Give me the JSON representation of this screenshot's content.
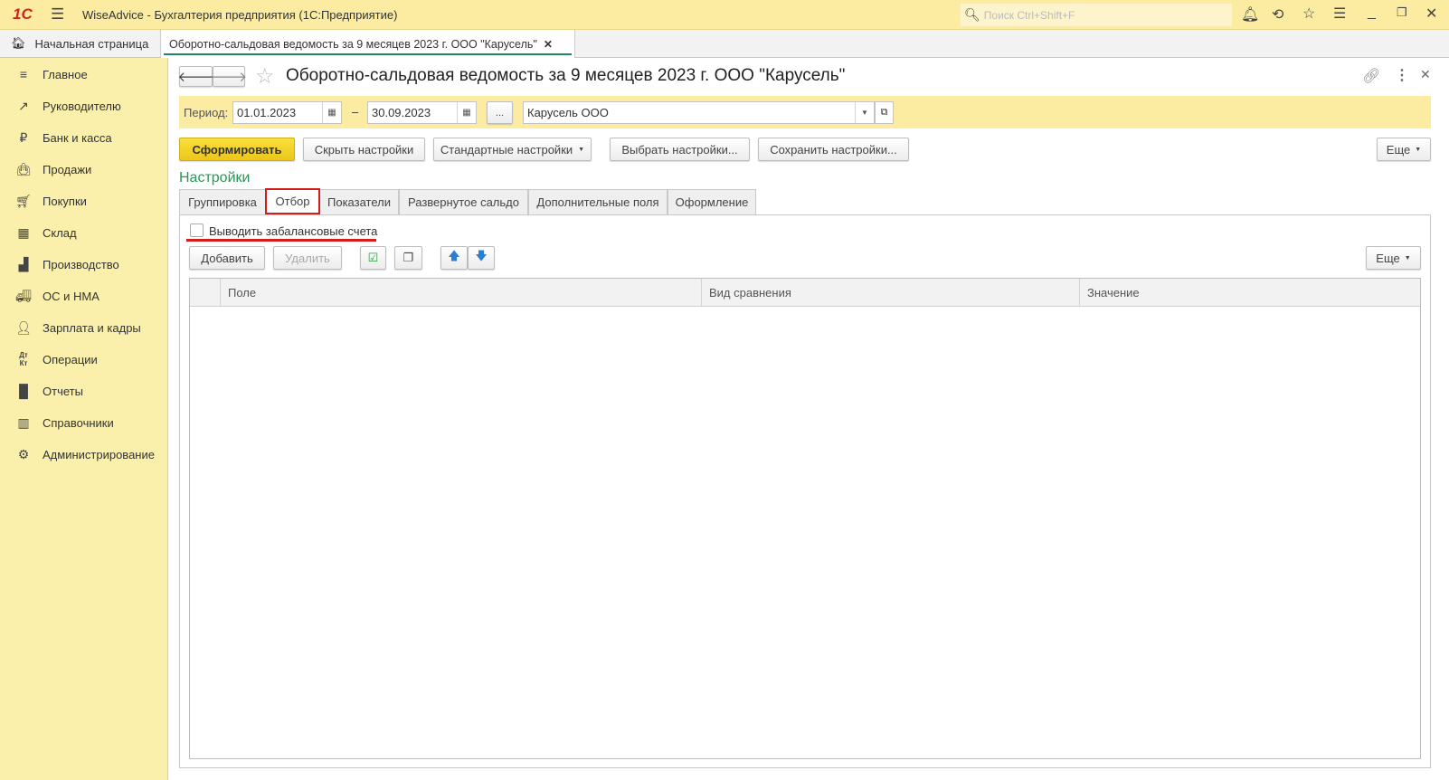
{
  "titlebar": {
    "app_title": "WiseAdvice - Бухгалтерия предприятия  (1С:Предприятие)",
    "search_placeholder": "Поиск Ctrl+Shift+F",
    "logo": "1С"
  },
  "tabs": {
    "home": "Начальная страница",
    "active": "Оборотно-сальдовая ведомость за 9 месяцев 2023 г. ООО \"Карусель\""
  },
  "sidebar": {
    "items": [
      {
        "label": "Главное",
        "icon": "menu-icon"
      },
      {
        "label": "Руководителю",
        "icon": "trend-icon"
      },
      {
        "label": "Банк и касса",
        "icon": "ruble-icon"
      },
      {
        "label": "Продажи",
        "icon": "bag-icon"
      },
      {
        "label": "Покупки",
        "icon": "cart-icon"
      },
      {
        "label": "Склад",
        "icon": "warehouse-icon"
      },
      {
        "label": "Производство",
        "icon": "factory-icon"
      },
      {
        "label": "ОС и НМА",
        "icon": "truck-icon"
      },
      {
        "label": "Зарплата и кадры",
        "icon": "person-icon"
      },
      {
        "label": "Операции",
        "icon": "dt-kt-icon"
      },
      {
        "label": "Отчеты",
        "icon": "chart-icon"
      },
      {
        "label": "Справочники",
        "icon": "books-icon"
      },
      {
        "label": "Администрирование",
        "icon": "gear-icon"
      }
    ]
  },
  "form": {
    "title": "Оборотно-сальдовая ведомость за 9 месяцев 2023 г. ООО \"Карусель\"",
    "period_label": "Период:",
    "date_from": "01.01.2023",
    "dash": "–",
    "date_to": "30.09.2023",
    "ellipsis": "...",
    "organization": "Карусель ООО",
    "buttons": {
      "generate": "Сформировать",
      "hide_settings": "Скрыть настройки",
      "standard_settings": "Стандартные настройки",
      "choose_settings": "Выбрать настройки...",
      "save_settings": "Сохранить настройки...",
      "more": "Еще"
    },
    "settings_heading": "Настройки",
    "settings_tabs": [
      "Группировка",
      "Отбор",
      "Показатели",
      "Развернутое сальдо",
      "Дополнительные поля",
      "Оформление"
    ],
    "checkbox_label": "Выводить забалансовые счета",
    "checkbox_checked": false,
    "filter_buttons": {
      "add": "Добавить",
      "delete": "Удалить",
      "more": "Еще"
    },
    "table_columns": [
      "Поле",
      "Вид сравнения",
      "Значение"
    ]
  }
}
